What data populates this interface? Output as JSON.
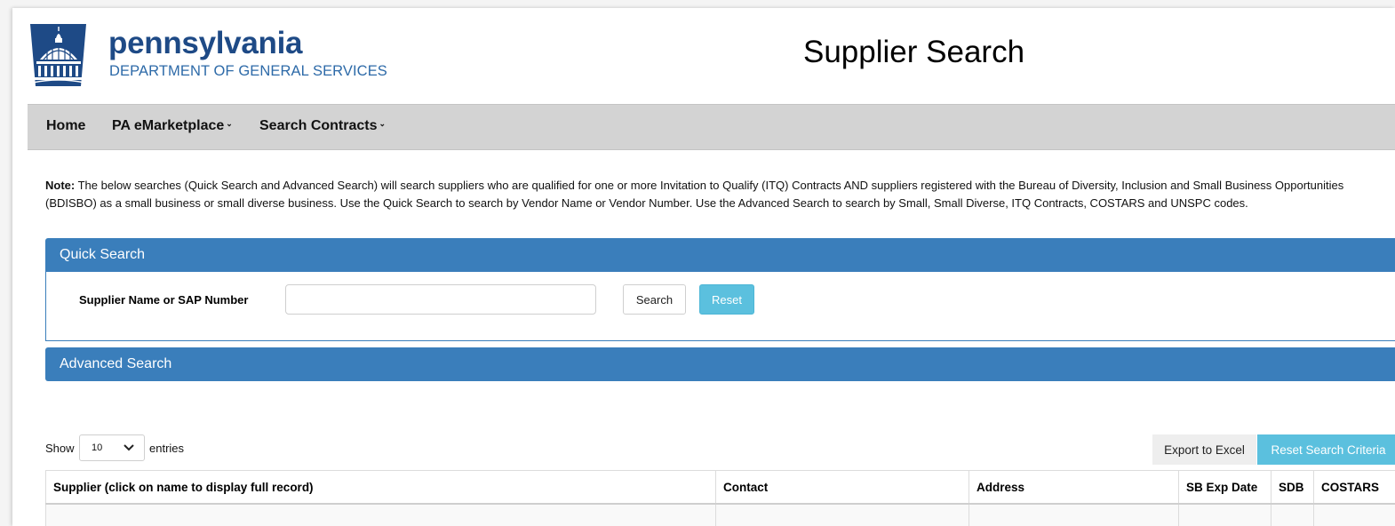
{
  "header": {
    "brand_name": "pennsylvania",
    "department": "DEPARTMENT OF GENERAL SERVICES",
    "page_title": "Supplier Search"
  },
  "nav": {
    "items": [
      {
        "label": "Home",
        "has_dropdown": false
      },
      {
        "label": "PA eMarketplace",
        "has_dropdown": true
      },
      {
        "label": "Search Contracts",
        "has_dropdown": true
      }
    ]
  },
  "note": {
    "prefix": "Note:",
    "text": " The below searches (Quick Search and Advanced Search) will search suppliers who are qualified for one or more Invitation to Qualify (ITQ) Contracts AND suppliers registered with the Bureau of Diversity, Inclusion and Small Business Opportunities (BDISBO) as a small business or small diverse business. Use the Quick Search to search by Vendor Name or Vendor Number. Use the Advanced Search to search by Small, Small Diverse, ITQ Contracts, COSTARS and UNSPC codes."
  },
  "quick_search": {
    "title": "Quick Search",
    "field_label": "Supplier Name or SAP Number",
    "field_value": "",
    "search_label": "Search",
    "reset_label": "Reset"
  },
  "advanced_search": {
    "title": "Advanced Search"
  },
  "table_controls": {
    "show_label": "Show",
    "entries_value": "10",
    "entries_label": "entries",
    "export_label": "Export to Excel",
    "reset_criteria_label": "Reset Search Criteria"
  },
  "table": {
    "columns": [
      "Supplier (click on name to display full record)",
      "Contact",
      "Address",
      "SB Exp Date",
      "SDB",
      "COSTARS"
    ]
  },
  "colors": {
    "panel_blue": "#3a7ebb",
    "info_button": "#5bc0de",
    "nav_gray": "#d3d3d3",
    "brand_navy": "#1e4a86"
  },
  "icons": {
    "logo": "capitol-dome-seal-icon",
    "dropdown": "chevron-down-icon"
  }
}
